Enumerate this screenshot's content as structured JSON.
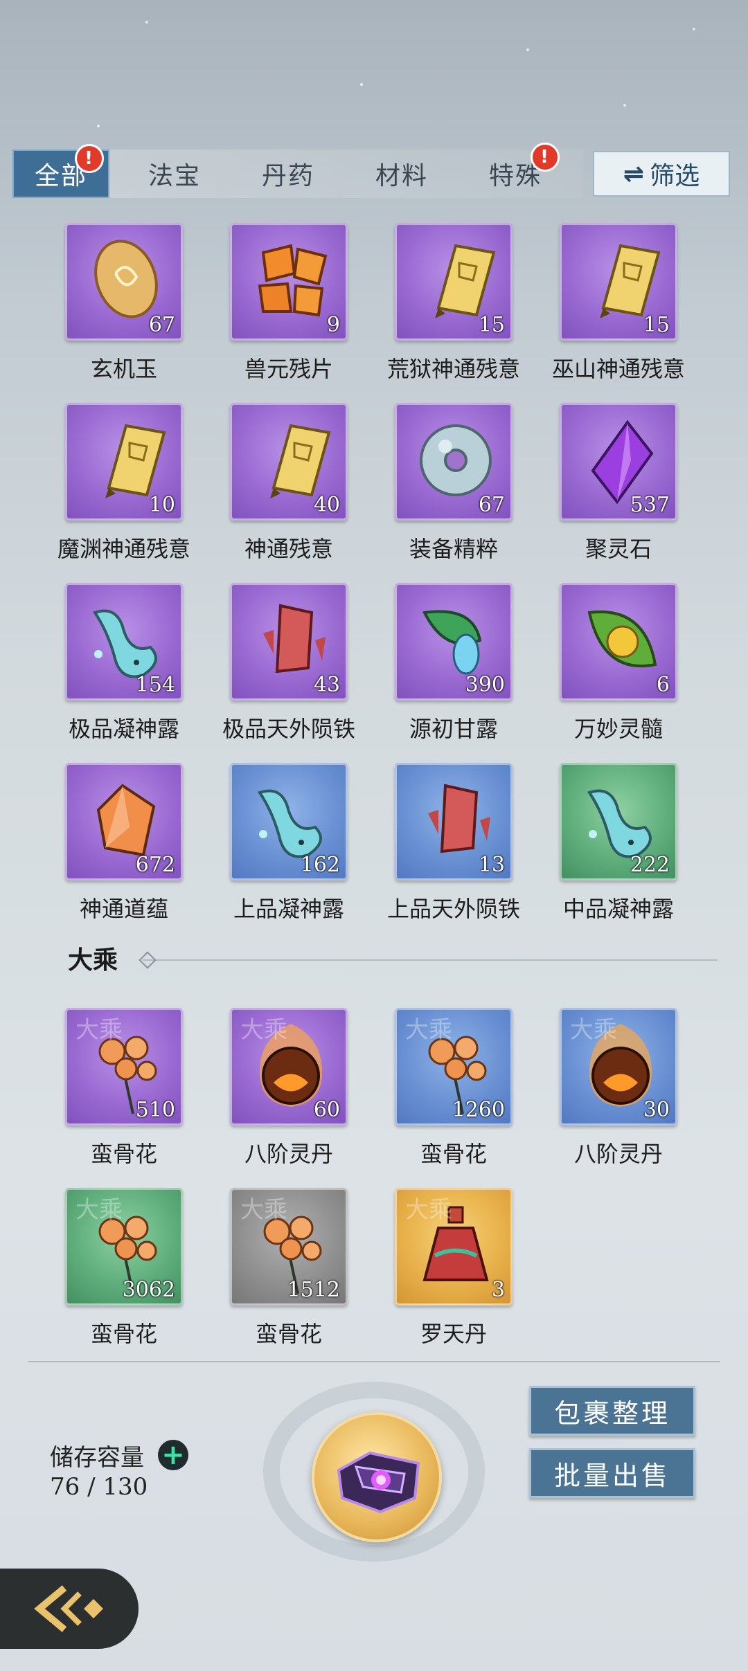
{
  "tabs": [
    {
      "label": "全部",
      "active": true,
      "badge": "!"
    },
    {
      "label": "法宝",
      "active": false
    },
    {
      "label": "丹药",
      "active": false
    },
    {
      "label": "材料",
      "active": false
    },
    {
      "label": "特殊",
      "active": false,
      "badge": "!"
    }
  ],
  "filter": {
    "icon": "swap-arrows-icon",
    "label": "筛选"
  },
  "items": [
    {
      "name": "玄机玉",
      "count": "67",
      "bg": "purple",
      "icon": "jade-gem-icon"
    },
    {
      "name": "兽元残片",
      "count": "9",
      "bg": "purple",
      "icon": "beast-fragments-icon"
    },
    {
      "name": "荒狱神通残意",
      "count": "15",
      "bg": "purple",
      "icon": "scroll-fragment-icon"
    },
    {
      "name": "巫山神通残意",
      "count": "15",
      "bg": "purple",
      "icon": "scroll-fragment-icon"
    },
    {
      "name": "魔渊神通残意",
      "count": "10",
      "bg": "purple",
      "icon": "scroll-fragment-icon"
    },
    {
      "name": "神通残意",
      "count": "40",
      "bg": "purple",
      "icon": "scroll-fragment-icon"
    },
    {
      "name": "装备精粹",
      "count": "67",
      "bg": "purple",
      "icon": "jade-ring-icon"
    },
    {
      "name": "聚灵石",
      "count": "537",
      "bg": "purple",
      "icon": "spirit-crystal-icon"
    },
    {
      "name": "极品凝神露",
      "count": "154",
      "bg": "purple",
      "icon": "dew-flask-icon"
    },
    {
      "name": "极品天外陨铁",
      "count": "43",
      "bg": "purple",
      "icon": "meteor-iron-icon"
    },
    {
      "name": "源初甘露",
      "count": "390",
      "bg": "purple",
      "icon": "dew-leaf-icon"
    },
    {
      "name": "万妙灵髓",
      "count": "6",
      "bg": "purple",
      "icon": "leaf-orb-icon"
    },
    {
      "name": "神通道蕴",
      "count": "672",
      "bg": "purple",
      "icon": "amber-crystal-icon"
    },
    {
      "name": "上品凝神露",
      "count": "162",
      "bg": "blue",
      "icon": "dew-flask-icon"
    },
    {
      "name": "上品天外陨铁",
      "count": "13",
      "bg": "blue",
      "icon": "meteor-iron-icon"
    },
    {
      "name": "中品凝神露",
      "count": "222",
      "bg": "green",
      "icon": "dew-flask-icon"
    }
  ],
  "section_title": "大乘",
  "section_items": [
    {
      "name": "蛮骨花",
      "count": "510",
      "bg": "purple",
      "icon": "orange-flower-icon",
      "tier": "大乘"
    },
    {
      "name": "八阶灵丹",
      "count": "60",
      "bg": "purple",
      "icon": "fire-pill-icon",
      "tier": "大乘"
    },
    {
      "name": "蛮骨花",
      "count": "1260",
      "bg": "blue",
      "icon": "orange-flower-icon",
      "tier": "大乘"
    },
    {
      "name": "八阶灵丹",
      "count": "30",
      "bg": "blue",
      "icon": "fire-pill-icon",
      "tier": "大乘"
    },
    {
      "name": "蛮骨花",
      "count": "3062",
      "bg": "green",
      "icon": "orange-flower-icon",
      "tier": "大乘"
    },
    {
      "name": "蛮骨花",
      "count": "1512",
      "bg": "gray",
      "icon": "orange-flower-icon",
      "tier": "大乘"
    },
    {
      "name": "罗天丹",
      "count": "3",
      "bg": "gold",
      "icon": "red-potion-icon",
      "tier": "大乘"
    }
  ],
  "storage": {
    "label": "储存容量",
    "value": "76 / 130"
  },
  "buttons": {
    "organize": "包裹整理",
    "bulk_sell": "批量出售"
  },
  "back": {
    "icon": "back-arrow-icon"
  }
}
